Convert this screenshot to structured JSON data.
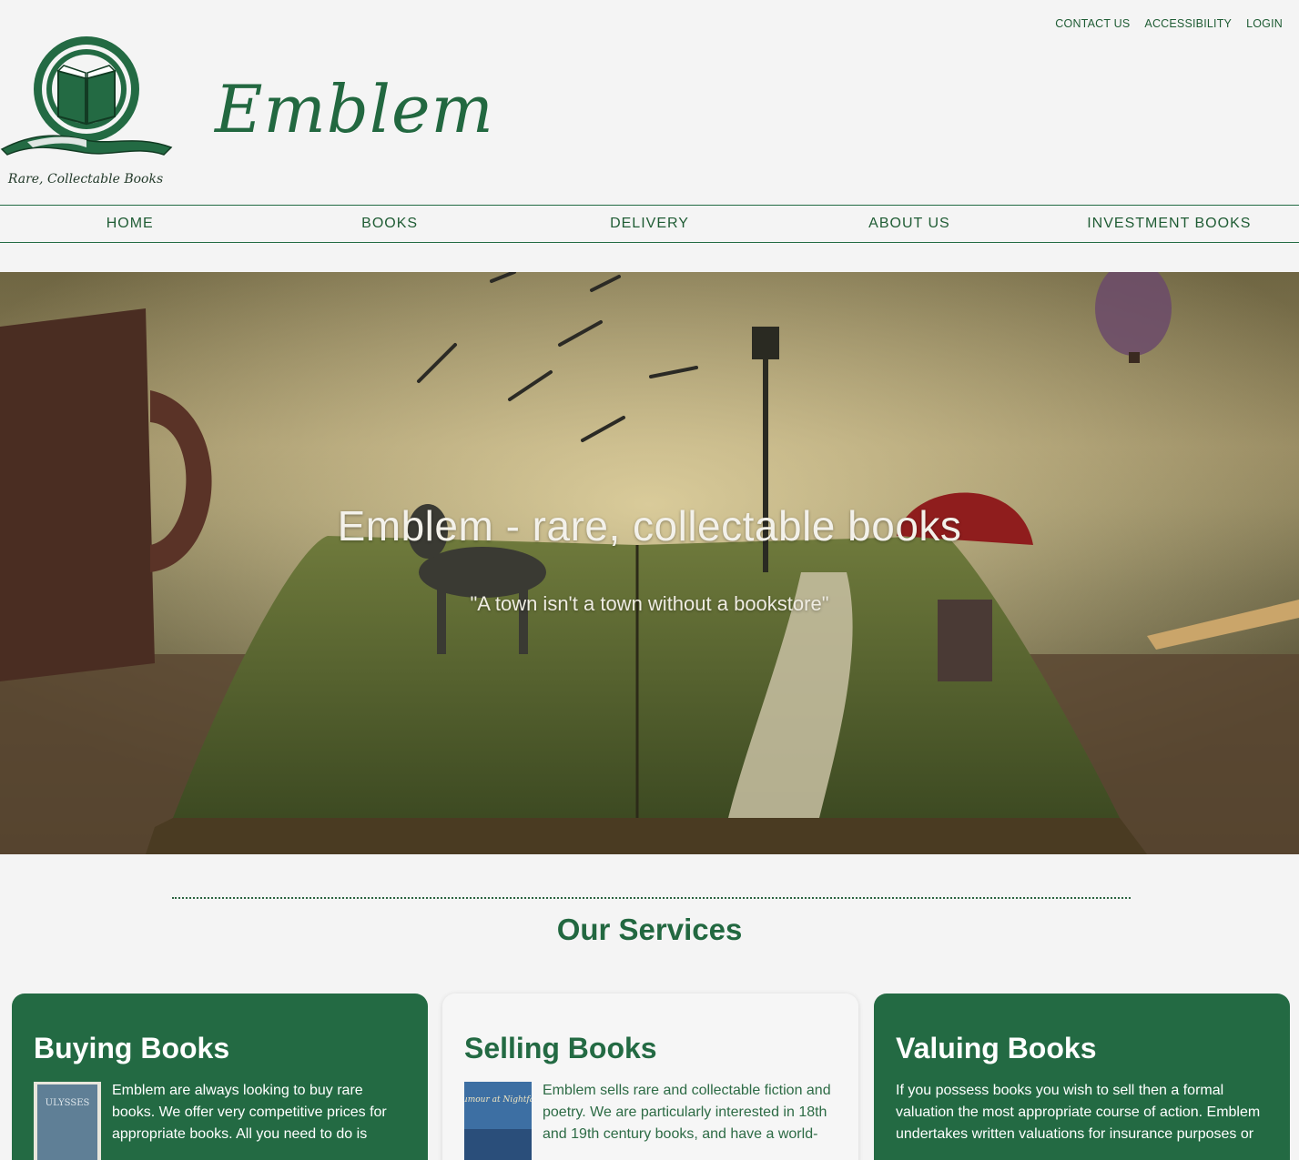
{
  "top_links": [
    "CONTACT US",
    "ACCESSIBILITY",
    "LOGIN"
  ],
  "logo": {
    "tagline": "Rare, Collectable Books"
  },
  "brand": "Emblem",
  "nav": [
    "HOME",
    "BOOKS",
    "DELIVERY",
    "ABOUT US",
    "INVESTMENT BOOKS"
  ],
  "hero": {
    "title": "Emblem - rare, collectable books",
    "subtitle": "\"A town isn't a town without a bookstore\""
  },
  "services": {
    "title": "Our Services",
    "cards": [
      {
        "title": "Buying Books",
        "image_label": "ULYSSES",
        "text": "Emblem are always looking to buy rare books. We offer very competitive prices for appropriate books. All you need to do is"
      },
      {
        "title": "Selling Books",
        "image_label": "Rumour at Nightfall",
        "text": "Emblem sells rare and collectable fiction and poetry. We are particularly interested in 18th and 19th century books, and have a world-"
      },
      {
        "title": "Valuing Books",
        "text": "If you possess books you wish to sell then a formal valuation the most appropriate course of action. Emblem undertakes written valuations for insurance purposes or"
      }
    ]
  },
  "colors": {
    "brand_green": "#236a43",
    "background": "#f4f4f4"
  }
}
